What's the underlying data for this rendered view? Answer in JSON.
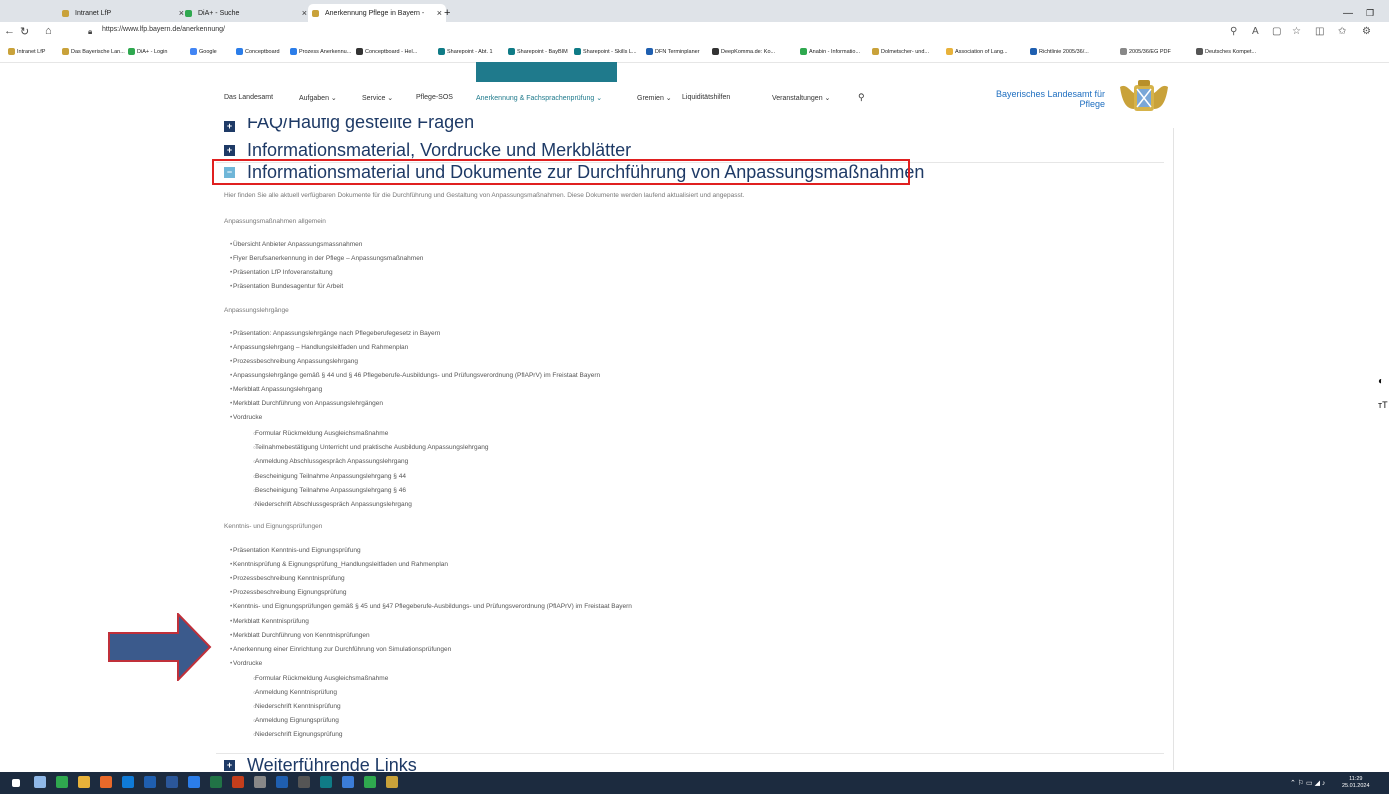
{
  "browser": {
    "tabs": [
      {
        "label": "Intranet LfP",
        "close": "×"
      },
      {
        "label": "DiA+ - Suche",
        "close": "×"
      },
      {
        "label": "Anerkennung Pflege in Bayern -",
        "close": "×"
      }
    ],
    "new_tab": "+",
    "url": "https://www.lfp.bayern.de/anerkennung/",
    "favorites": [
      "Intranet LfP",
      "Das Bayerische Lan...",
      "DiA+ - Login",
      "Google",
      "Conceptboard",
      "Prozess Anerkennu...",
      "Conceptboard - Hel...",
      "Sharepoint - Abt. 1",
      "Sharepoint - BayBIM",
      "Sharepoint - Skills L...",
      "DFN Terminplaner",
      "DeepKomma.de: Ko...",
      "Anabin - Informatio...",
      "Dolmetscher- und...",
      "Association of Lang...",
      "Richtlinie 2005/36/...",
      "2005/36/EG PDF",
      "Deutsches Kompet..."
    ]
  },
  "site": {
    "nav": [
      "Das Landesamt",
      "Aufgaben ⌄",
      "Service ⌄",
      "Pflege-SOS",
      "Anerkennung & Fachsprachenprüfung ⌄",
      "Gremien ⌄",
      "Liquiditätshilfen",
      "Veranstaltungen ⌄"
    ],
    "brand": "Bayerisches Landesamt für Pflege"
  },
  "accordion": {
    "faq": "FAQ/Häufig gestellte Fragen",
    "info": "Informationsmaterial, Vordrucke und Merkblätter",
    "open": "Informationsmaterial und Dokumente zur Durchführung von Anpassungsmaßnahmen",
    "next": "Weiterführende Links"
  },
  "content": {
    "intro": "Hier finden Sie alle aktuell verfügbaren Dokumente für die Durchführung und Gestaltung von Anpassungsmaßnahmen. Diese Dokumente werden laufend aktualisiert und angepasst.",
    "s1_title": "Anpassungsmaßnahmen allgemein",
    "s1_items": [
      "Übersicht Anbieter Anpassungsmassnahmen",
      "Flyer Berufsanerkennung in der Pflege – Anpassungsmaßnahmen",
      "Präsentation LfP Infoveranstaltung",
      "Präsentation Bundesagentur für Arbeit"
    ],
    "s2_title": "Anpassungslehrgänge",
    "s2_items": [
      "Präsentation: Anpassungslehrgänge nach Pflegeberufegesetz in Bayern",
      "Anpassungslehrgang – Handlungsleitfaden und Rahmenplan",
      "Prozessbeschreibung Anpassungslehrgang",
      "Anpassungslehrgänge gemäß § 44 und § 46 Pflegeberufe-Ausbildungs- und Prüfungsverordnung (PflAPrV) im Freistaat Bayern",
      "Merkblatt Anpassungslehrgang",
      "Merkblatt Durchführung von Anpassungslehrgängen",
      "Vordrucke"
    ],
    "s2_sub": [
      "Formular Rückmeldung Ausgleichsmaßnahme",
      "Teilnahmebestätigung Unterricht und praktische Ausbildung Anpassungslehrgang",
      "Anmeldung Abschlussgespräch Anpassungslehrgang",
      "Bescheinigung Teilnahme Anpassungslehrgang § 44",
      "Bescheinigung Teilnahme Anpassungslehrgang § 46",
      "Niederschrift Abschlussgespräch Anpassungslehrgang"
    ],
    "s3_title": "Kenntnis- und Eignungsprüfungen",
    "s3_items": [
      "Präsentation Kenntnis-und Eignungsprüfung",
      "Kenntnisprüfung & Eignungsprüfung_Handlungsleitfaden und Rahmenplan",
      "Prozessbeschreibung Kenntnisprüfung",
      "Prozessbeschreibung Eignungsprüfung",
      "Kenntnis- und Eignungsprüfungen gemäß § 45 und §47 Pflegeberufe-Ausbildungs- und Prüfungsverordnung (PflAPrV) im Freistaat Bayern",
      "Merkblatt Kenntnisprüfung",
      "Merkblatt Durchführung von Kenntnisprüfungen",
      "Anerkennung einer Einrichtung zur Durchführung von Simulationsprüfungen",
      "Vordrucke"
    ],
    "s3_sub": [
      "Formular Rückmeldung Ausgleichsmaßnahme",
      "Anmeldung Kenntnisprüfung",
      "Niederschrift Kenntnisprüfung",
      "Anmeldung Eignungsprüfung",
      "Niederschrift Eignungsprüfung"
    ]
  },
  "taskbar": {
    "time": "11:29",
    "date": "25.01.2024"
  },
  "colors": {
    "highlight": "#e02020",
    "arrow": "#3b5a8c",
    "teal": "#1f7a8c"
  }
}
